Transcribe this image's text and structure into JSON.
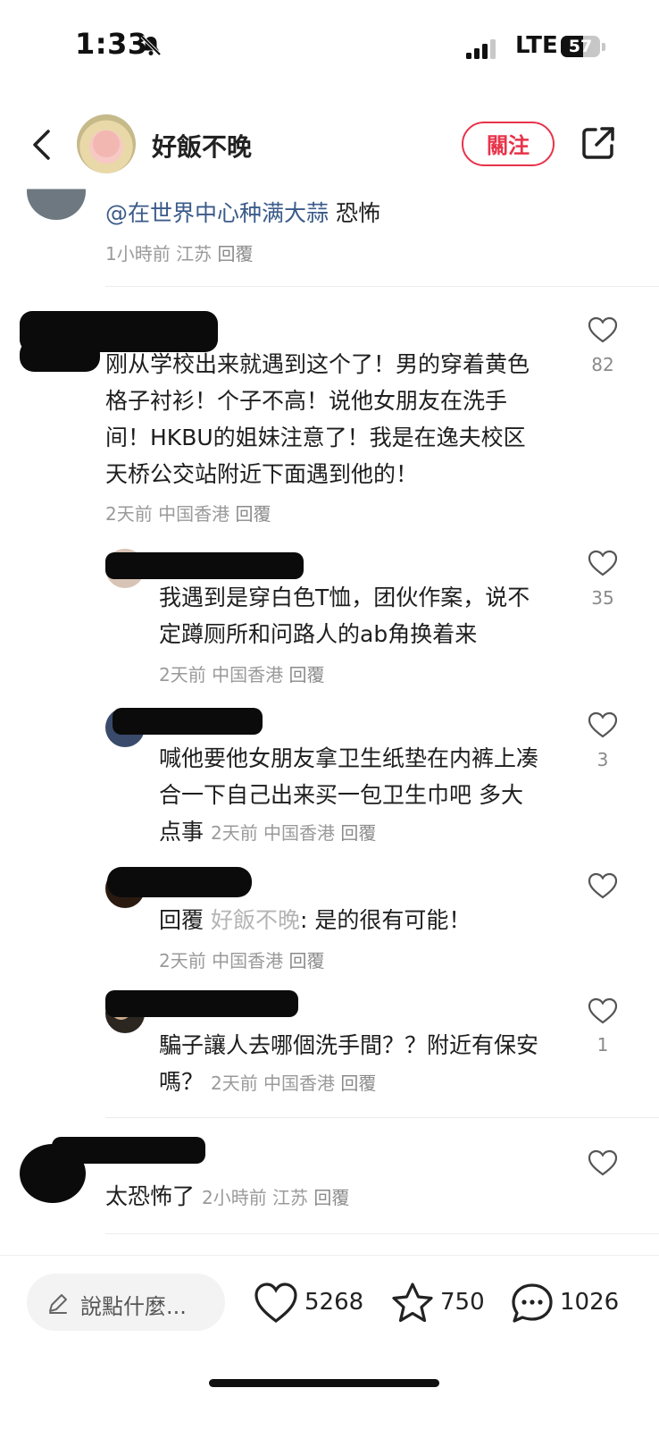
{
  "status": {
    "time": "1:33",
    "network": "LTE",
    "battery": "57"
  },
  "header": {
    "username": "好飯不晚",
    "follow_label": "關注"
  },
  "comments": [
    {
      "mention": "@在世界中心种满大蒜",
      "text": " 恐怖",
      "meta": "1小時前 江苏",
      "reply": "回覆"
    },
    {
      "lines": [
        "刚从学校出来就遇到这个了！男的穿着黄色",
        "格子衬衫！个子不高！说他女朋友在洗手",
        "间！HKBU的姐妹注意了！我是在逸夫校区",
        "天桥公交站附近下面遇到他的！"
      ],
      "meta": "2天前 中国香港",
      "reply": "回覆",
      "likes": "82"
    },
    {
      "lines": [
        "我遇到是穿白色T恤，团伙作案，说不",
        "定蹲厕所和问路人的ab角换着来"
      ],
      "meta": "2天前 中国香港",
      "reply": "回覆",
      "likes": "35"
    },
    {
      "lines": [
        "喊他要他女朋友拿卫生纸垫在内裤上凑",
        "合一下自己出来买一包卫生巾吧 多大"
      ],
      "last_line": "点事",
      "meta": "2天前 中国香港",
      "reply": "回覆",
      "likes": "3"
    },
    {
      "reply_prefix": "回覆",
      "reply_to": "好飯不晚",
      "text": ": 是的很有可能！",
      "meta": "2天前 中国香港",
      "reply": "回覆"
    },
    {
      "lines": [
        "騙子讓人去哪個洗手間？？附近有保安"
      ],
      "last_line": "嗎？",
      "meta": "2天前 中国香港",
      "reply": "回覆",
      "likes": "1"
    },
    {
      "text": "太恐怖了",
      "meta": "2小時前 江苏",
      "reply": "回覆"
    }
  ],
  "bottom": {
    "input_placeholder": "說點什麼...",
    "likes": "5268",
    "stars": "750",
    "comments": "1026"
  },
  "icons": [
    "bell-slash-icon",
    "signal-icon",
    "battery-icon",
    "back-icon",
    "share-icon",
    "heart-icon",
    "star-icon",
    "comment-icon",
    "pencil-icon"
  ],
  "colors": {
    "accent": "#e8334a",
    "mention": "#3b5b8a"
  }
}
